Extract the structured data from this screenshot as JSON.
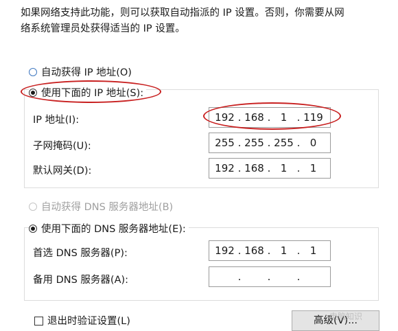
{
  "description_lines": [
    "如果网络支持此功能，则可以获取自动指派的 IP 设置。否则，你需要从网",
    "络系统管理员处获得适当的 IP 设置。"
  ],
  "ip_options": {
    "auto_label": "自动获得 IP 地址(O)",
    "manual_label": "使用下面的 IP 地址(S):",
    "selected": "manual"
  },
  "ip_fields": [
    {
      "label": "IP 地址(I):",
      "octets": [
        "192",
        "168",
        "1",
        "119"
      ]
    },
    {
      "label": "子网掩码(U):",
      "octets": [
        "255",
        "255",
        "255",
        "0"
      ]
    },
    {
      "label": "默认网关(D):",
      "octets": [
        "192",
        "168",
        "1",
        "1"
      ]
    }
  ],
  "dns_options": {
    "auto_label": "自动获得 DNS 服务器地址(B)",
    "manual_label": "使用下面的 DNS 服务器地址(E):",
    "selected": "manual"
  },
  "dns_fields": [
    {
      "label": "首选 DNS 服务器(P):",
      "octets": [
        "192",
        "168",
        "1",
        "1"
      ]
    },
    {
      "label": "备用 DNS 服务器(A):",
      "octets": [
        "",
        "",
        "",
        ""
      ]
    }
  ],
  "validate_checkbox": {
    "label": "退出时验证设置(L)",
    "checked": false
  },
  "advanced_button": {
    "label": "高级(V)..."
  },
  "watermark": "电脑知识",
  "colors": {
    "highlight_ellipse": "#c82020",
    "radio_accent": "#3f78c0"
  }
}
